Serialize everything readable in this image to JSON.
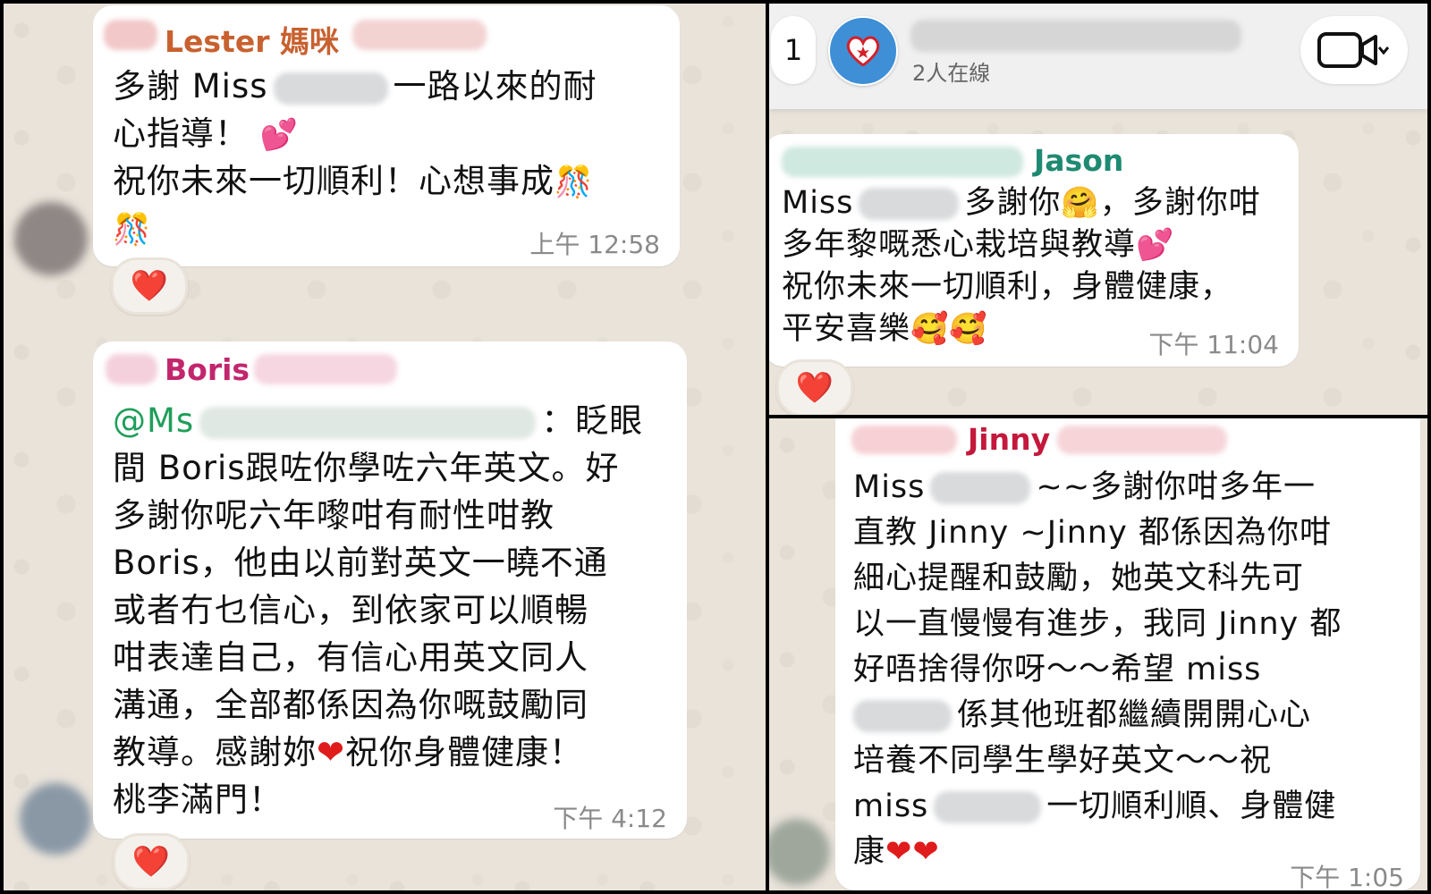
{
  "left_panel": {
    "lester": {
      "sender": "Lester 媽咪",
      "lines": [
        "多謝 Miss",
        "一路以來的耐",
        "心指導！",
        "祝你未來一切順利！心想事成"
      ],
      "time": "上午 12:58",
      "reaction": "❤️"
    },
    "boris": {
      "sender": "Boris",
      "mention": "@Ms",
      "mention_tail": "：眨眼",
      "lines": [
        "間 Boris跟咗你學咗六年英文。好",
        "多謝你呢六年嚟咁有耐性咁教",
        "Boris，他由以前對英文一曉不通",
        "或者冇乜信心，到依家可以順暢",
        "咁表達自己，有信心用英文同人",
        "溝通，全部都係因為你嘅鼓勵同",
        "教導。感謝妳",
        "祝你身體健康！",
        "桃李滿門！"
      ],
      "time": "下午 4:12",
      "reaction": "❤️"
    }
  },
  "top_right_panel": {
    "header": {
      "back_count": "1",
      "online_status": "2人在線"
    },
    "jason": {
      "sender": "Jason",
      "lines": [
        "Miss",
        "多謝你",
        "，多謝你咁",
        "多年黎嘅悉心栽培與教導",
        "祝你未來一切順利，身體健康，",
        "平安喜樂"
      ],
      "time": "下午 11:04",
      "reaction": "❤️"
    }
  },
  "bottom_right_panel": {
    "jinny": {
      "sender": "Jinny",
      "lines": [
        "Miss",
        "~~多謝你咁多年一",
        "直教 Jinny ~Jinny 都係因為你咁",
        "細心提醒和鼓勵，她英文科先可",
        "以一直慢慢有進步，我同 Jinny 都",
        "好唔捨得你呀～～希望 miss",
        "係其他班都繼續開開心心",
        "培養不同學生學好英文～～祝",
        "miss",
        "一切順利順、身體健",
        "康"
      ],
      "time": "下午 1:05"
    }
  },
  "colors": {
    "lester": "#c8612f",
    "boris": "#c2266d",
    "jason": "#1f8a72",
    "jinny": "#c4183c",
    "mention": "#1e9e5a",
    "heart": "#e01b1b",
    "chat_bg": "#e9e3da"
  }
}
